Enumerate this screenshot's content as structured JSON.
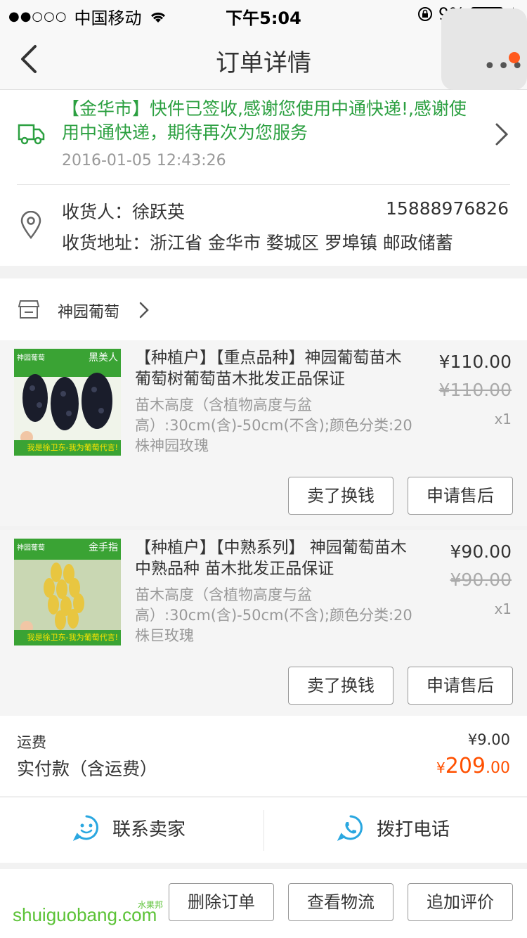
{
  "status_bar": {
    "signal": "●●○○○",
    "carrier": "中国移动",
    "time": "下午5:04",
    "battery": "9%",
    "battery_level": 0.09
  },
  "header": {
    "title": "订单详情"
  },
  "logistics": {
    "message": "【金华市】快件已签收,感谢您使用中通快递!,感谢使用中通快递，期待再次为您服务",
    "time": "2016-01-05 12:43:26"
  },
  "receiver": {
    "name": "收货人：徐跃英",
    "phone": "15888976826",
    "address": "收货地址：浙江省 金华市 婺城区 罗埠镇 邮政储蓄"
  },
  "shop": {
    "name": "神园葡萄"
  },
  "items": [
    {
      "title": "【种植户】【重点品种】神园葡萄苗木葡萄树葡萄苗木批发正品保证",
      "spec": "苗木高度（含植物高度与盆高）:30cm(含)-50cm(不含);颜色分类:20株神园玫瑰",
      "price": "¥110.00",
      "original_price": "¥110.00",
      "qty": "x1",
      "thumb_label": "黑美人",
      "thumb_brand": "神园葡萄",
      "thumb_slogan": "我是徐卫东-我为葡萄代言!",
      "sell_btn": "卖了换钱",
      "service_btn": "申请售后"
    },
    {
      "title": "【种植户】【中熟系列】 神园葡萄苗木中熟品种 苗木批发正品保证",
      "spec": "苗木高度（含植物高度与盆高）:30cm(含)-50cm(不含);颜色分类:20株巨玫瑰",
      "price": "¥90.00",
      "original_price": "¥90.00",
      "qty": "x1",
      "thumb_label": "金手指",
      "thumb_brand": "神园葡萄",
      "thumb_slogan": "我是徐卫东-我为葡萄代言!",
      "sell_btn": "卖了换钱",
      "service_btn": "申请售后"
    }
  ],
  "totals": {
    "shipping_label": "运费",
    "shipping_value": "¥9.00",
    "paid_label": "实付款（含运费）",
    "paid_currency": "¥",
    "paid_int": "209",
    "paid_dec": ".00"
  },
  "contact": {
    "seller": "联系卖家",
    "call": "拨打电话"
  },
  "actions": {
    "delete": "删除订单",
    "logistics": "查看物流",
    "review": "追加评价"
  },
  "watermark": {
    "text": "shuiguobang.com",
    "cn": "水果邦"
  },
  "colors": {
    "accent_green": "#2ca041",
    "price_orange": "#ff5000",
    "icon_blue": "#2aa7e0"
  }
}
